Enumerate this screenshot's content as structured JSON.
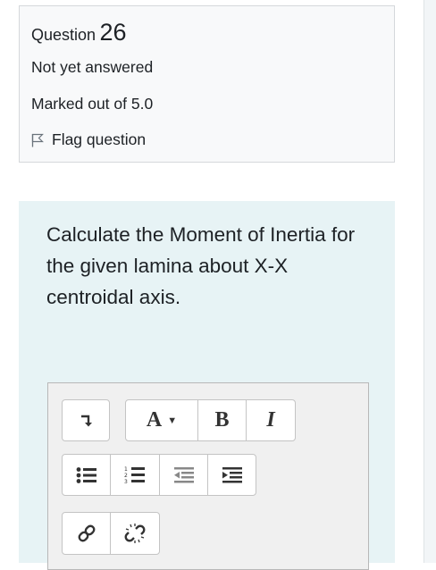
{
  "question_info": {
    "label": "Question",
    "number": "26",
    "state": "Not yet answered",
    "grade": "Marked out of 5.0",
    "flag_label": "Flag question"
  },
  "question_text": "Calculate the Moment of Inertia for the given lamina about X-X centroidal axis.",
  "editor_toolbar": {
    "font_button_label": "A",
    "bold_label": "B",
    "italic_label": "I",
    "icons": [
      "collapse-icon",
      "font-style-icon",
      "bold-icon",
      "italic-icon",
      "unordered-list-icon",
      "ordered-list-icon",
      "outdent-icon",
      "indent-icon",
      "link-icon",
      "unlink-icon"
    ]
  }
}
